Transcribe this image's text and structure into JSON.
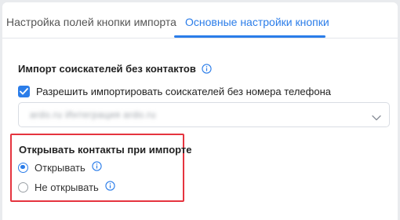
{
  "tabs": [
    {
      "label": "Настройка полей кнопки импорта",
      "active": false
    },
    {
      "label": "Основные настройки кнопки",
      "active": true
    }
  ],
  "import_section": {
    "title": "Импорт соискателей без контактов",
    "info_icon": "info-circle-icon",
    "checkbox": {
      "label": "Разрешить импортировать соискателей без номера телефона",
      "checked": true
    },
    "select": {
      "value": "ardo.ru   Интеграция ardo.ru",
      "blurred": true,
      "chevron_icon": "chevron-down-icon"
    }
  },
  "open_contacts": {
    "title": "Открывать контакты при импорте",
    "options": [
      {
        "label": "Открывать",
        "selected": true
      },
      {
        "label": "Не открывать",
        "selected": false
      }
    ],
    "highlight_color": "#e5343f"
  },
  "colors": {
    "accent": "#2b7de9",
    "background": "#e9ebee",
    "panel": "#ffffff"
  }
}
